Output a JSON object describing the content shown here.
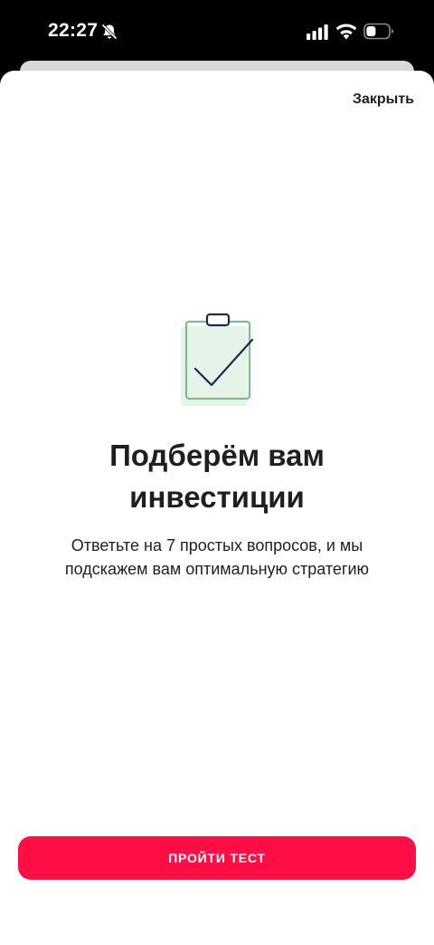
{
  "status_bar": {
    "time": "22:27",
    "icons": [
      "bell-muted-icon",
      "signal-icon",
      "wifi-icon",
      "battery-icon"
    ]
  },
  "header": {
    "close_label": "Закрыть"
  },
  "content": {
    "illustration": "clipboard-check-icon",
    "title": "Подберём вам инвестиции",
    "subtitle": "Ответьте на 7 простых вопросов, и мы подскажем вам оптимальную стратегию"
  },
  "footer": {
    "cta_label": "ПРОЙТИ ТЕСТ"
  },
  "colors": {
    "accent": "#ff0e46",
    "text": "#1f1f1f",
    "illustration_green": "#7fb992",
    "illustration_navy": "#1c2a4f",
    "illustration_fill": "#e6f3e9"
  }
}
